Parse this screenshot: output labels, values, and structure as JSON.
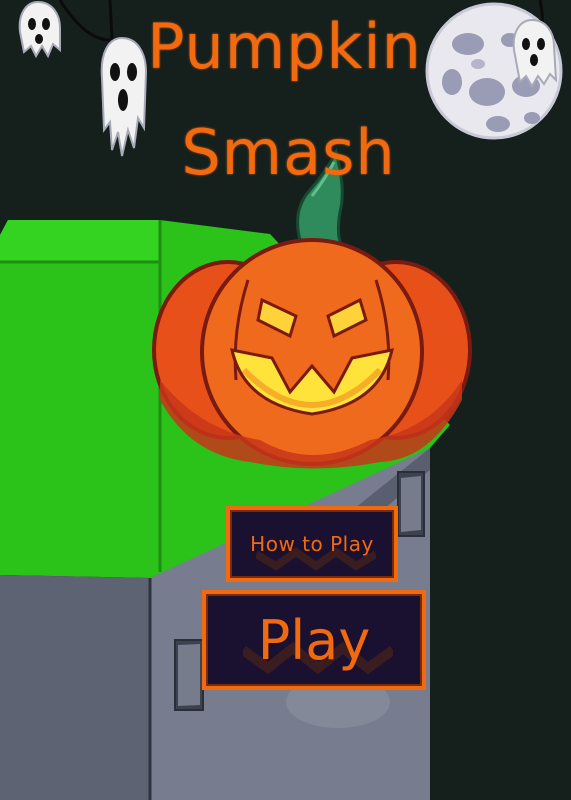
{
  "game": {
    "title_line1": "Pumpkin",
    "title_line2": "Smash"
  },
  "menu": {
    "how_to_play_label": "How to Play",
    "play_label": "Play"
  },
  "colors": {
    "background": "#15201d",
    "accent_orange": "#f26a10",
    "button_fill": "#1a1030",
    "table_green": "#2bc21a",
    "table_gray": "#5a5f6e"
  },
  "icons": [
    "ghost-icon",
    "moon-icon",
    "pumpkin-icon"
  ]
}
